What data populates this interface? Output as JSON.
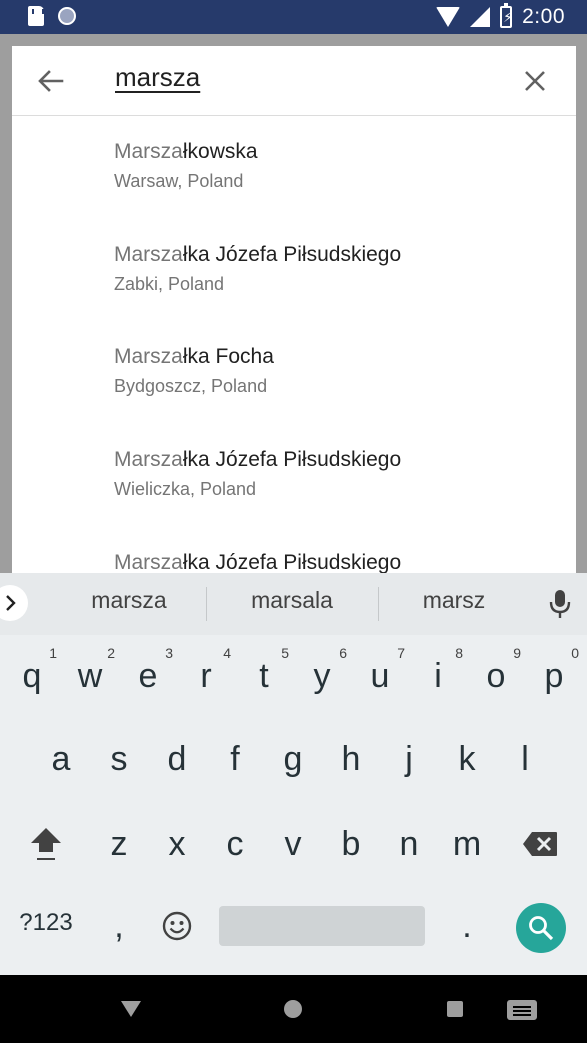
{
  "status_bar": {
    "time": "2:00",
    "icons": [
      "sd-card-icon",
      "moon-icon",
      "wifi-icon",
      "signal-icon",
      "battery-charging-icon"
    ]
  },
  "search": {
    "query": "marsza",
    "back_icon": "arrow-left-icon",
    "clear_icon": "close-icon"
  },
  "results": [
    {
      "match": "Marsza",
      "rest": "łkowska",
      "subtitle": "Warsaw, Poland"
    },
    {
      "match": "Marsza",
      "rest": "łka Józefa Piłsudskiego",
      "subtitle": "Zabki, Poland"
    },
    {
      "match": "Marsza",
      "rest": "łka Focha",
      "subtitle": "Bydgoszcz, Poland"
    },
    {
      "match": "Marsza",
      "rest": "łka Józefa Piłsudskiego",
      "subtitle": "Wieliczka, Poland"
    },
    {
      "match": "Marsza",
      "rest": "łka Józefa Piłsudskiego",
      "subtitle": ""
    }
  ],
  "keyboard": {
    "suggestions": [
      "marsza",
      "marsala",
      "marsz"
    ],
    "row1": [
      {
        "key": "q",
        "hint": "1"
      },
      {
        "key": "w",
        "hint": "2"
      },
      {
        "key": "e",
        "hint": "3"
      },
      {
        "key": "r",
        "hint": "4"
      },
      {
        "key": "t",
        "hint": "5"
      },
      {
        "key": "y",
        "hint": "6"
      },
      {
        "key": "u",
        "hint": "7"
      },
      {
        "key": "i",
        "hint": "8"
      },
      {
        "key": "o",
        "hint": "9"
      },
      {
        "key": "p",
        "hint": "0"
      }
    ],
    "row2": [
      "a",
      "s",
      "d",
      "f",
      "g",
      "h",
      "j",
      "k",
      "l"
    ],
    "row3": [
      "z",
      "x",
      "c",
      "v",
      "b",
      "n",
      "m"
    ],
    "symbols_label": "?123",
    "comma": ",",
    "period": ".",
    "accent_color": "#26a69a"
  }
}
